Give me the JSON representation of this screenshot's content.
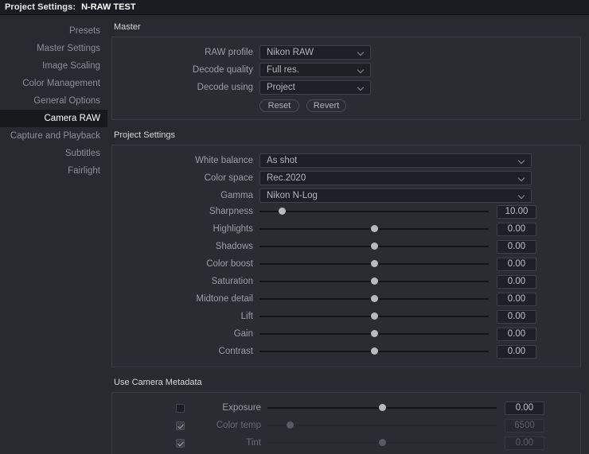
{
  "titlebar": {
    "label": "Project Settings:",
    "project_name": "N-RAW TEST"
  },
  "sidebar": {
    "items": [
      {
        "label": "Presets",
        "selected": false
      },
      {
        "label": "Master Settings",
        "selected": false
      },
      {
        "label": "Image Scaling",
        "selected": false
      },
      {
        "label": "Color Management",
        "selected": false
      },
      {
        "label": "General Options",
        "selected": false
      },
      {
        "label": "Camera RAW",
        "selected": true
      },
      {
        "label": "Capture and Playback",
        "selected": false
      },
      {
        "label": "Subtitles",
        "selected": false
      },
      {
        "label": "Fairlight",
        "selected": false
      }
    ]
  },
  "master": {
    "title": "Master",
    "fields": [
      {
        "label": "RAW profile",
        "value": "Nikon RAW"
      },
      {
        "label": "Decode quality",
        "value": "Full res."
      },
      {
        "label": "Decode using",
        "value": "Project"
      }
    ],
    "reset_label": "Reset",
    "revert_label": "Revert"
  },
  "project_settings": {
    "title": "Project Settings",
    "selects": [
      {
        "label": "White balance",
        "value": "As shot"
      },
      {
        "label": "Color space",
        "value": "Rec.2020"
      },
      {
        "label": "Gamma",
        "value": "Nikon N-Log"
      }
    ],
    "sliders": [
      {
        "label": "Sharpness",
        "value": "10.00",
        "pos": 10
      },
      {
        "label": "Highlights",
        "value": "0.00",
        "pos": 50
      },
      {
        "label": "Shadows",
        "value": "0.00",
        "pos": 50
      },
      {
        "label": "Color boost",
        "value": "0.00",
        "pos": 50
      },
      {
        "label": "Saturation",
        "value": "0.00",
        "pos": 50
      },
      {
        "label": "Midtone detail",
        "value": "0.00",
        "pos": 50
      },
      {
        "label": "Lift",
        "value": "0.00",
        "pos": 50
      },
      {
        "label": "Gain",
        "value": "0.00",
        "pos": 50
      },
      {
        "label": "Contrast",
        "value": "0.00",
        "pos": 50
      }
    ]
  },
  "camera_metadata": {
    "title": "Use Camera Metadata",
    "rows": [
      {
        "label": "Exposure",
        "value": "0.00",
        "pos": 50,
        "checked": false,
        "disabled": false
      },
      {
        "label": "Color temp",
        "value": "6500",
        "pos": 10,
        "checked": true,
        "disabled": true
      },
      {
        "label": "Tint",
        "value": "0.00",
        "pos": 50,
        "checked": true,
        "disabled": true
      }
    ]
  },
  "colors": {
    "window_bg": "#292a30",
    "titlebar_bg": "#1b1c21",
    "panel_bg": "#2b2c32",
    "selected_nav_bg": "#18191d",
    "field_bg": "#1f2025"
  }
}
